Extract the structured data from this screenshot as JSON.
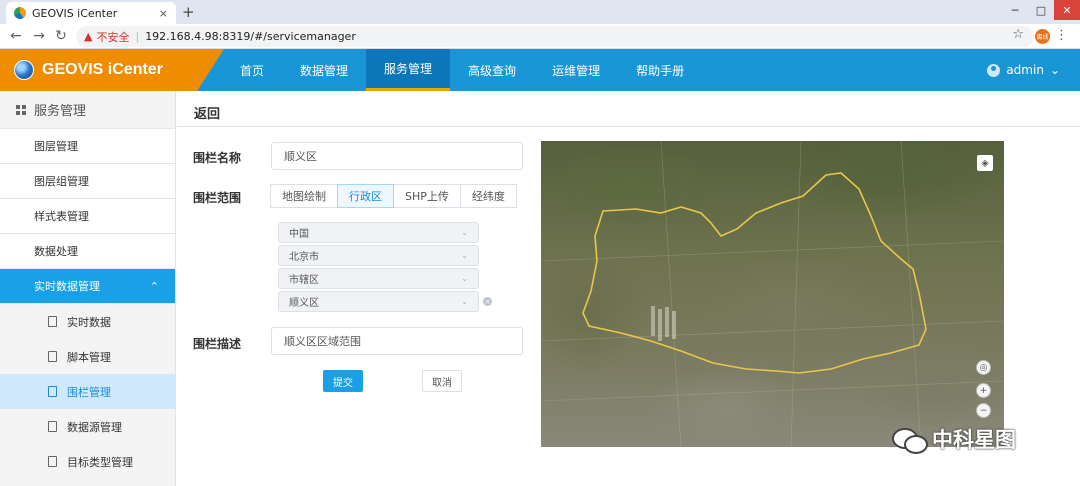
{
  "browser": {
    "tab_title": "GEOVIS iCenter",
    "tab_close": "×",
    "new_tab": "+",
    "win_min": "─",
    "win_max": "□",
    "win_close": "✕",
    "back": "←",
    "forward": "→",
    "reload": "↻",
    "warning_glyph": "▲",
    "insecure_label": "不安全",
    "separator": "|",
    "url": "192.168.4.98:8319/#/servicemanager",
    "star": "☆",
    "extension_label": "离线",
    "menu": "⋮"
  },
  "header": {
    "brand": "GEOVIS iCenter",
    "nav": [
      "首页",
      "数据管理",
      "服务管理",
      "高级查询",
      "运维管理",
      "帮助手册"
    ],
    "active_nav": "服务管理",
    "user": "admin",
    "user_chevron": "⌄"
  },
  "sidebar": {
    "title": "服务管理",
    "items": [
      "图层管理",
      "图层组管理",
      "样式表管理",
      "数据处理"
    ],
    "open_group": {
      "label": "实时数据管理",
      "chevron": "⌃"
    },
    "sub_items": [
      "实时数据",
      "脚本管理",
      "围栏管理",
      "数据源管理",
      "目标类型管理"
    ],
    "active_sub": "围栏管理"
  },
  "main": {
    "back": "返回",
    "name_label": "围栏名称",
    "name_value": "顺义区",
    "range_label": "围栏范围",
    "range_tabs": [
      "地图绘制",
      "行政区",
      "SHP上传",
      "经纬度"
    ],
    "active_range_tab": "行政区",
    "selects": [
      "中国",
      "北京市",
      "市辖区",
      "顺义区"
    ],
    "chevron": "⌄",
    "clear": "×",
    "desc_label": "围栏描述",
    "desc_value": "顺义区区域范围",
    "submit": "提交",
    "cancel": "取消"
  },
  "map": {
    "layers": "◈",
    "locate": "◎",
    "zoom_in": "+",
    "zoom_out": "−",
    "boundary_color": "#e8c74a"
  },
  "watermark": "中科星图",
  "colors": {
    "accent": "#1896d6",
    "brand": "#f08c00",
    "active_sub": "#cfe8fb"
  }
}
